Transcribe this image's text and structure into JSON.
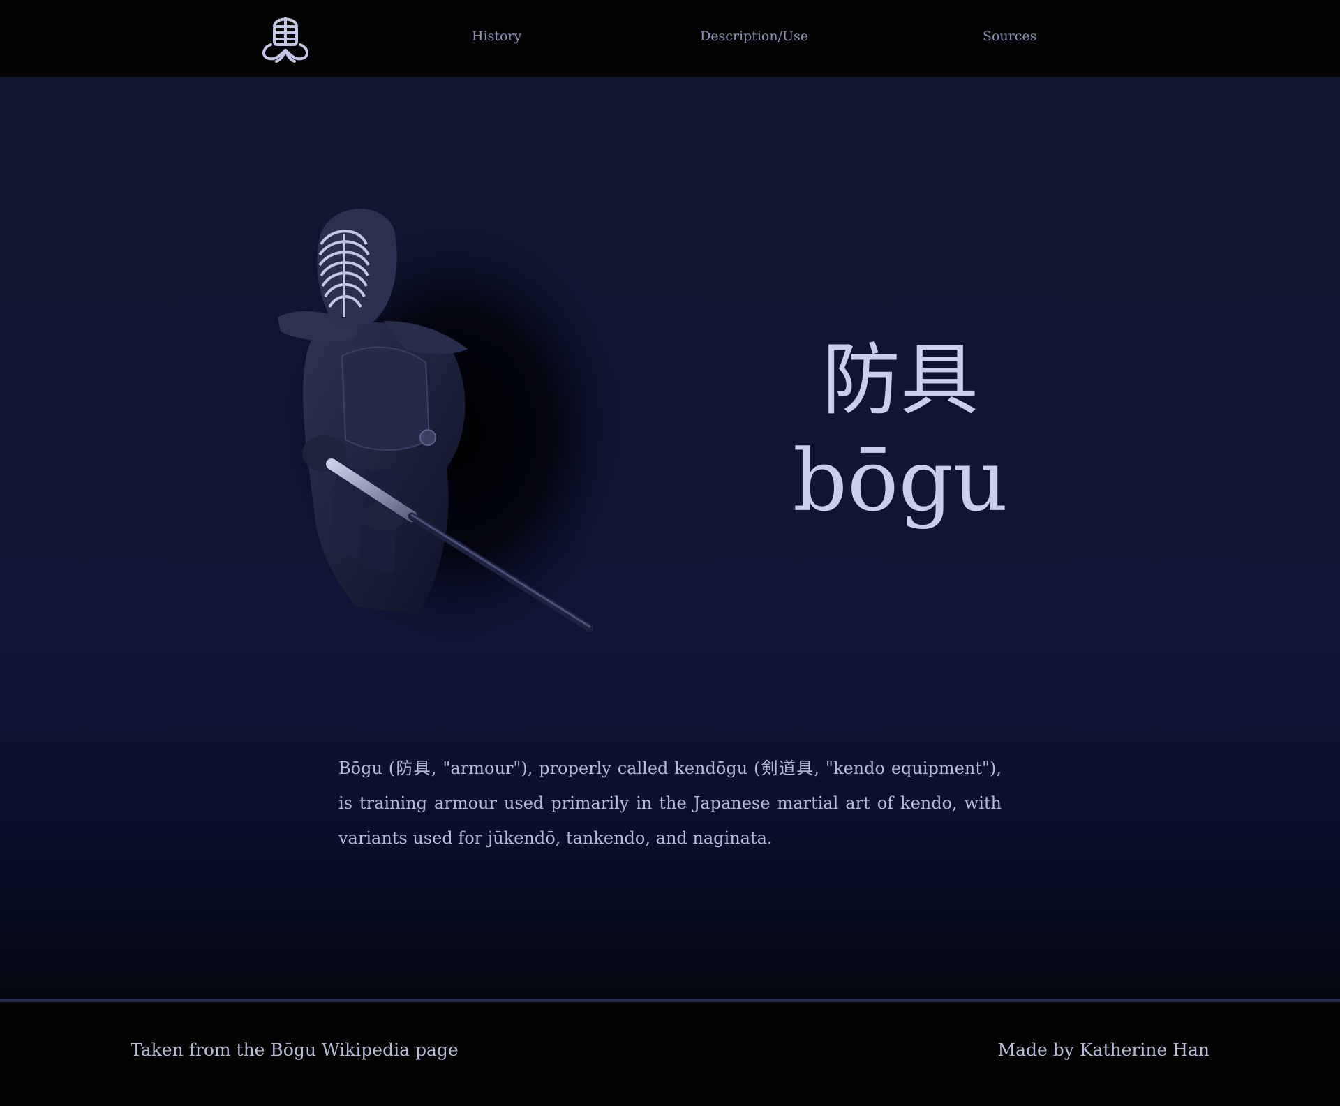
{
  "header": {
    "logo_icon": "kendo-men-logo-icon",
    "nav": [
      {
        "label": "History"
      },
      {
        "label": "Description/Use"
      },
      {
        "label": "Sources"
      }
    ]
  },
  "hero": {
    "image": "kendoka-in-bogu-image",
    "title_kanji": "防具",
    "title_romaji": "bōgu",
    "description": "Bōgu (防具, \"armour\"), properly called kendōgu (剣道具, \"kendo equipment\"), is training armour used primarily in the Japanese martial art of kendo, with variants used for jūkendō, tankendo, and naginata."
  },
  "footer": {
    "left_text": "Taken from the Bōgu Wikipedia page",
    "right_text": "Made by Katherine Han"
  },
  "colors": {
    "header_bg": "#030303",
    "hero_bg_top": "#10162d",
    "hero_bg_bottom": "#03050f",
    "text": "#c4c8e6",
    "nav_text": "#8d92b8",
    "footer_rule": "#2a2f4f"
  }
}
